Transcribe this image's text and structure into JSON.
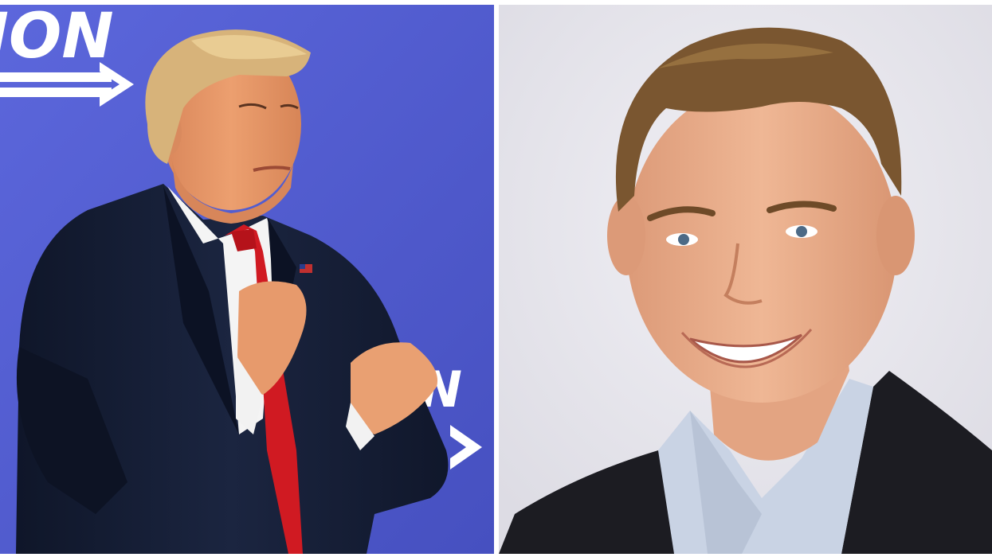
{
  "left_panel": {
    "banner_text": "ION",
    "banner_text_fragment": "N",
    "colors": {
      "stage_background": "#4a55c8",
      "stage_background_light": "#5c67dc",
      "banner_text": "#ffffff",
      "suit": "#141c33",
      "shirt": "#f4f4f4",
      "tie": "#d01a22",
      "hair": "#d7b37a",
      "skin": "#e79a6c"
    },
    "icons": [
      "arrow-right-icon",
      "flag-pin-icon"
    ]
  },
  "right_panel": {
    "colors": {
      "background": "#e7e6ec",
      "jacket": "#1c1c22",
      "shirt": "#c9d3e4",
      "hair": "#7a5630",
      "skin": "#eab08e"
    }
  }
}
